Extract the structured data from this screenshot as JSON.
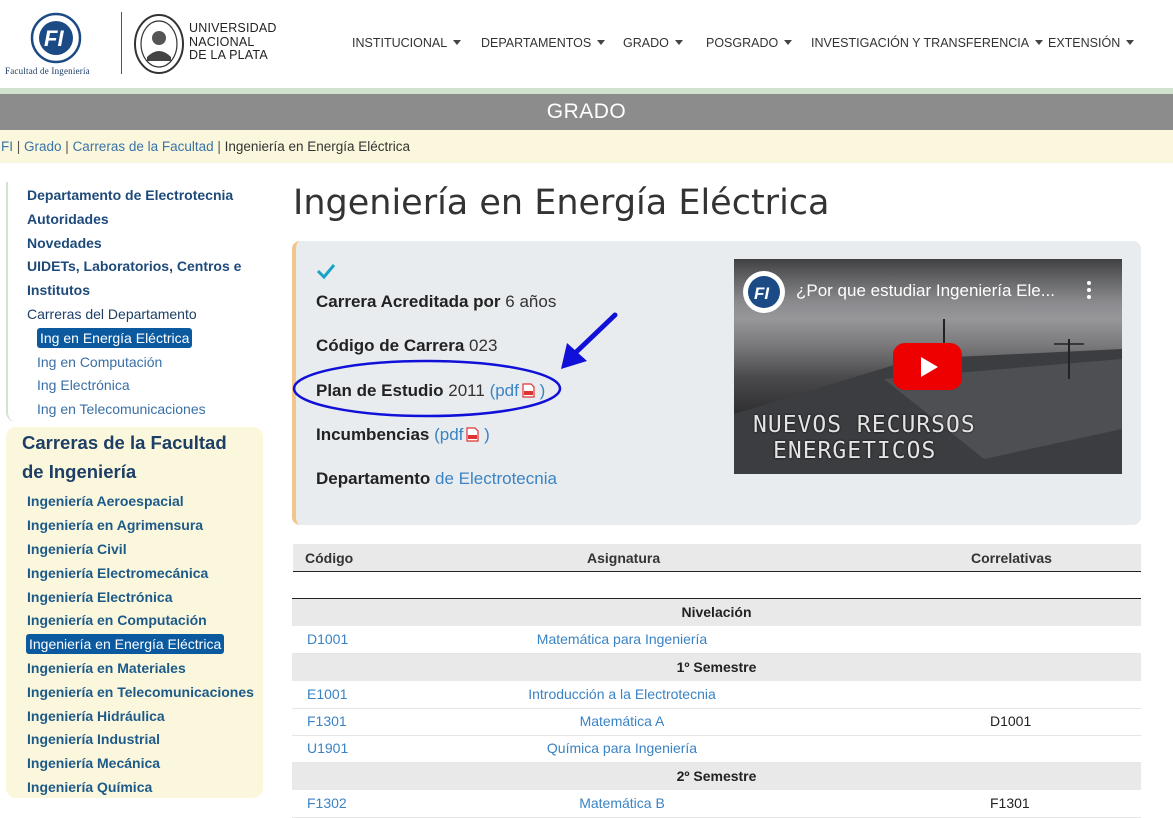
{
  "header": {
    "fi_caption": "Facultad de Ingeniería",
    "fi_mark": "FI",
    "unlp_lines": [
      "UNIVERSIDAD",
      "NACIONAL",
      "DE LA PLATA"
    ],
    "nav": [
      "INSTITUCIONAL",
      "DEPARTAMENTOS",
      "GRADO",
      "POSGRADO",
      "INVESTIGACIÓN Y TRANSFERENCIA",
      "EXTENSIÓN"
    ]
  },
  "banner": "GRADO",
  "breadcrumb": [
    "FI",
    "Grado",
    "Carreras de la Facultad",
    "Ingeniería en Energía Eléctrica"
  ],
  "sidebar": {
    "dept_links": [
      "Departamento de Electrotecnia",
      "Autoridades",
      "Novedades",
      "UIDETs, Laboratorios, Centros e",
      "Institutos"
    ],
    "dept_careers_label": "Carreras del Departamento",
    "dept_careers": [
      "Ing en Energía Eléctrica",
      "Ing en Computación",
      "Ing Electrónica",
      "Ing en Telecomunicaciones"
    ],
    "faculty_title_1": "Carreras de la Facultad",
    "faculty_title_2": "de Ingeniería",
    "faculty_careers": [
      "Ingeniería Aeroespacial",
      "Ingeniería en Agrimensura",
      "Ingeniería Civil",
      "Ingeniería Electromecánica",
      "Ingeniería Electrónica",
      "Ingeniería en Computación",
      "Ingeniería en Energía Eléctrica",
      "Ingeniería en Materiales",
      "Ingeniería en Telecomunicaciones",
      "Ingeniería Hidráulica",
      "Ingeniería Industrial",
      "Ingeniería Mecánica",
      "Ingeniería Química"
    ]
  },
  "main": {
    "title": "Ingeniería en Energía Eléctrica",
    "accredited_label": "Carrera Acreditada por",
    "accredited_value": "6 años",
    "code_label": "Código de Carrera",
    "code_value": "023",
    "plan_label": "Plan de Estudio",
    "plan_value": "2011",
    "pdf_label": "(pdf",
    "pdf_close": ")",
    "incumbencias_label": "Incumbencias",
    "dept_label": "Departamento",
    "dept_value": "de Electrotecnia"
  },
  "video": {
    "title": "¿Por que estudiar Ingeniería Ele...",
    "caption_1": "NUEVOS RECURSOS",
    "caption_2": "ENERGETICOS"
  },
  "table": {
    "headers": [
      "Código",
      "Asignatura",
      "Correlativas"
    ],
    "sections": [
      {
        "name": "Nivelación",
        "rows": [
          {
            "code": "D1001",
            "subject": "Matemática para Ingeniería",
            "corr": ""
          }
        ]
      },
      {
        "name": "1º Semestre",
        "rows": [
          {
            "code": "E1001",
            "subject": "Introducción a la Electrotecnia",
            "corr": ""
          },
          {
            "code": "F1301",
            "subject": "Matemática A",
            "corr": "D1001"
          },
          {
            "code": "U1901",
            "subject": "Química para Ingeniería",
            "corr": ""
          }
        ]
      },
      {
        "name": "2º Semestre",
        "rows": [
          {
            "code": "F1302",
            "subject": "Matemática B",
            "corr": "F1301"
          }
        ]
      }
    ]
  },
  "colors": {
    "accent": "#0b5aa0",
    "link": "#3a83c4",
    "annotation": "#1010d8"
  }
}
